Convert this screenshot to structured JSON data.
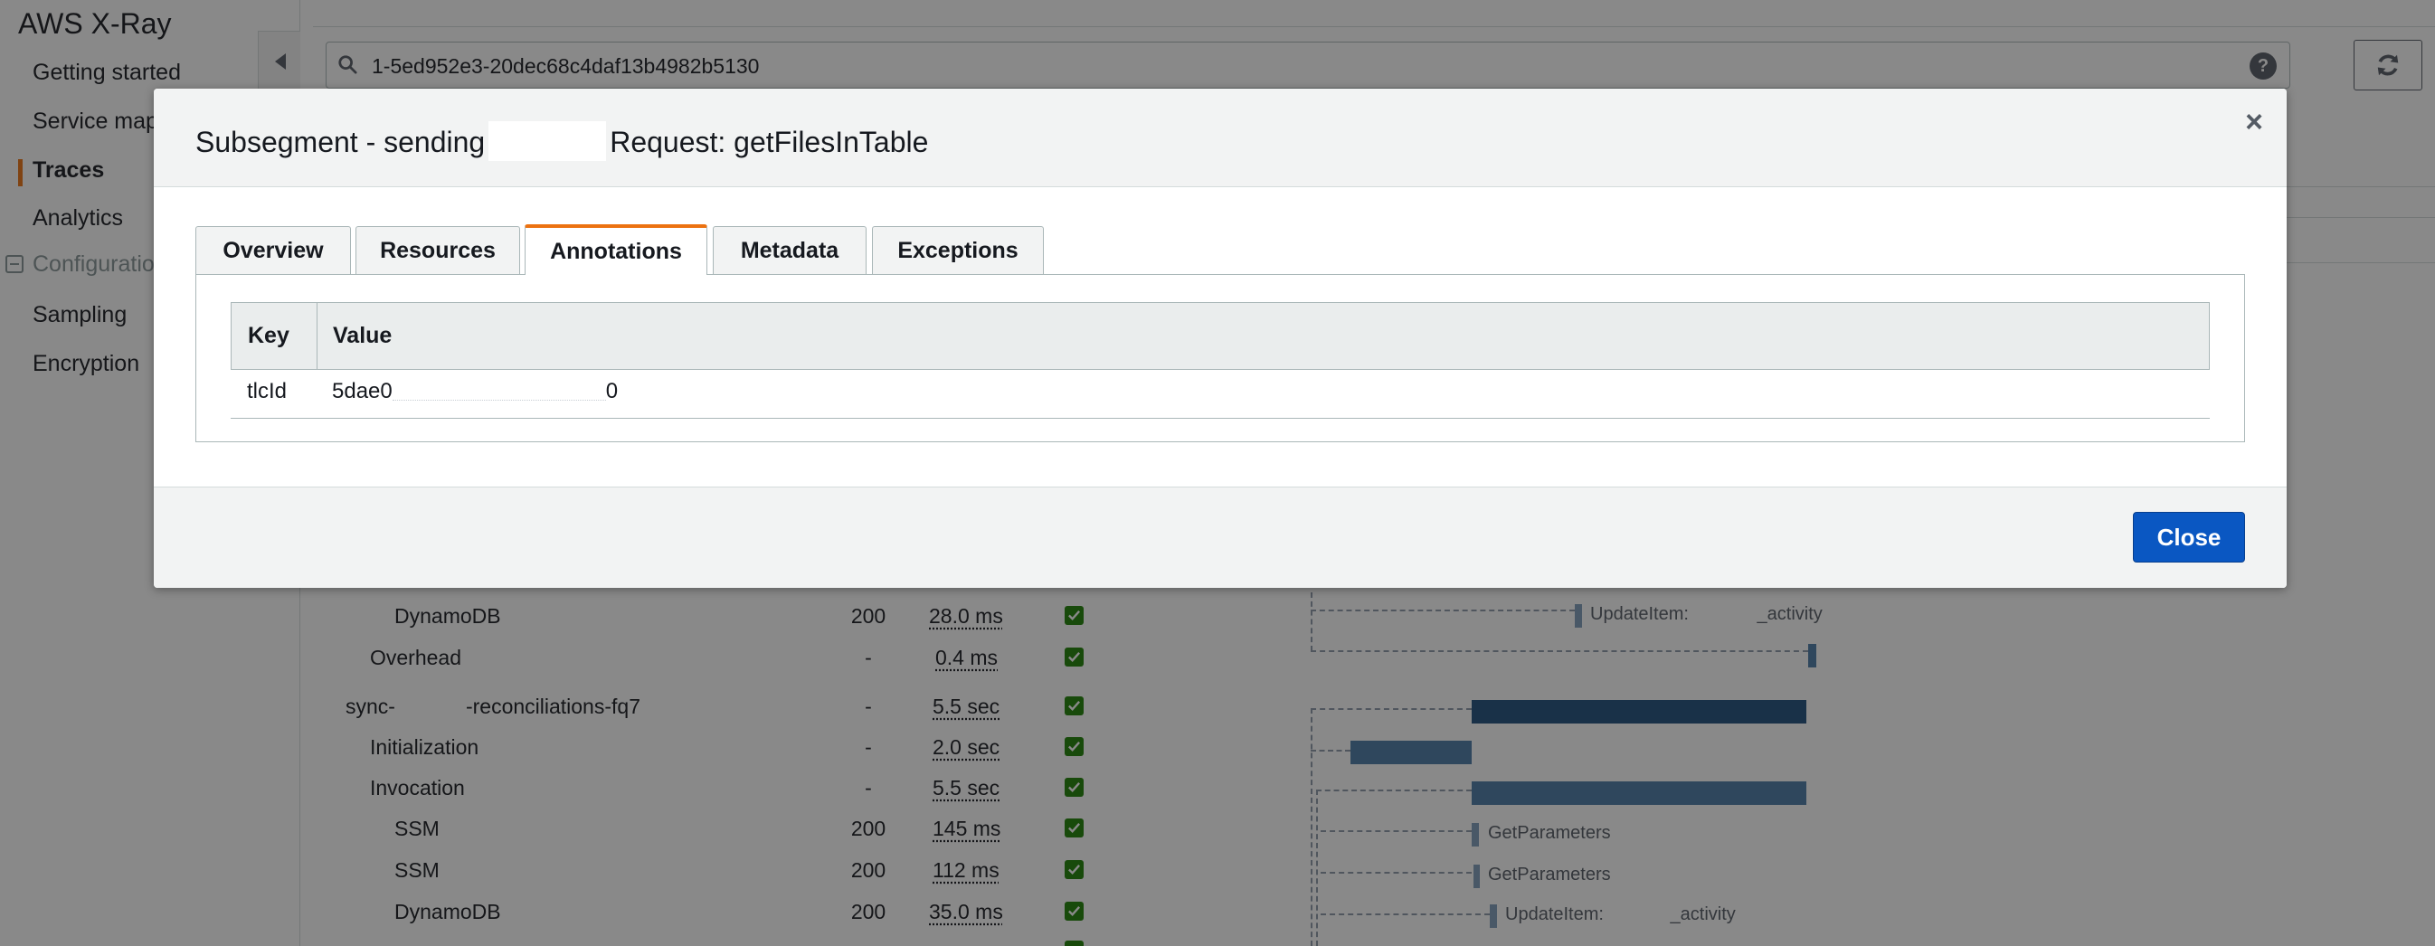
{
  "sidebar": {
    "title": "AWS X-Ray",
    "items": [
      {
        "label": "Getting started"
      },
      {
        "label": "Service map"
      },
      {
        "label": "Traces"
      },
      {
        "label": "Analytics"
      },
      {
        "label": "Configuration"
      },
      {
        "label": "Sampling"
      },
      {
        "label": "Encryption"
      }
    ]
  },
  "search": {
    "value": "1-5ed952e3-20dec68c4daf13b4982b5130",
    "help_glyph": "?"
  },
  "trace_rows": [
    {
      "label": "DynamoDB",
      "status": "200",
      "duration": "28.0 ms",
      "bar_label": "UpdateItem: ",
      "bar_label_suffix": "_activity"
    },
    {
      "label": "Overhead",
      "status": "-",
      "duration": "0.4 ms"
    },
    {
      "label_prefix": "sync-",
      "label_suffix": "-reconciliations-fq7",
      "status": "-",
      "duration": "5.5 sec"
    },
    {
      "label": "Initialization",
      "status": "-",
      "duration": "2.0 sec"
    },
    {
      "label": "Invocation",
      "status": "-",
      "duration": "5.5 sec"
    },
    {
      "label": "SSM",
      "status": "200",
      "duration": "145 ms",
      "bar_label": "GetParameters"
    },
    {
      "label": "SSM",
      "status": "200",
      "duration": "112 ms",
      "bar_label": "GetParameters"
    },
    {
      "label": "DynamoDB",
      "status": "200",
      "duration": "35.0 ms",
      "bar_label": "UpdateItem: ",
      "bar_label_suffix": "_activity"
    }
  ],
  "modal": {
    "title_prefix": "Subsegment - sending",
    "title_suffix": "Request: getFilesInTable",
    "close_x": "×",
    "tabs": [
      {
        "label": "Overview"
      },
      {
        "label": "Resources"
      },
      {
        "label": "Annotations"
      },
      {
        "label": "Metadata"
      },
      {
        "label": "Exceptions"
      }
    ],
    "selected_tab": "Annotations",
    "table": {
      "headers": [
        "Key",
        "Value"
      ],
      "rows": [
        {
          "key": "tlcId",
          "value_prefix": "5dae0",
          "value_suffix": "0"
        }
      ]
    },
    "close_button": "Close"
  },
  "colors": {
    "accent_orange": "#ec7211",
    "primary_blue": "#0a57c2",
    "bar_dark": "#1f4f7d",
    "bar_mid": "#4a7aa6",
    "bar_light": "#7f9cbb",
    "check_green": "#1d8102"
  }
}
